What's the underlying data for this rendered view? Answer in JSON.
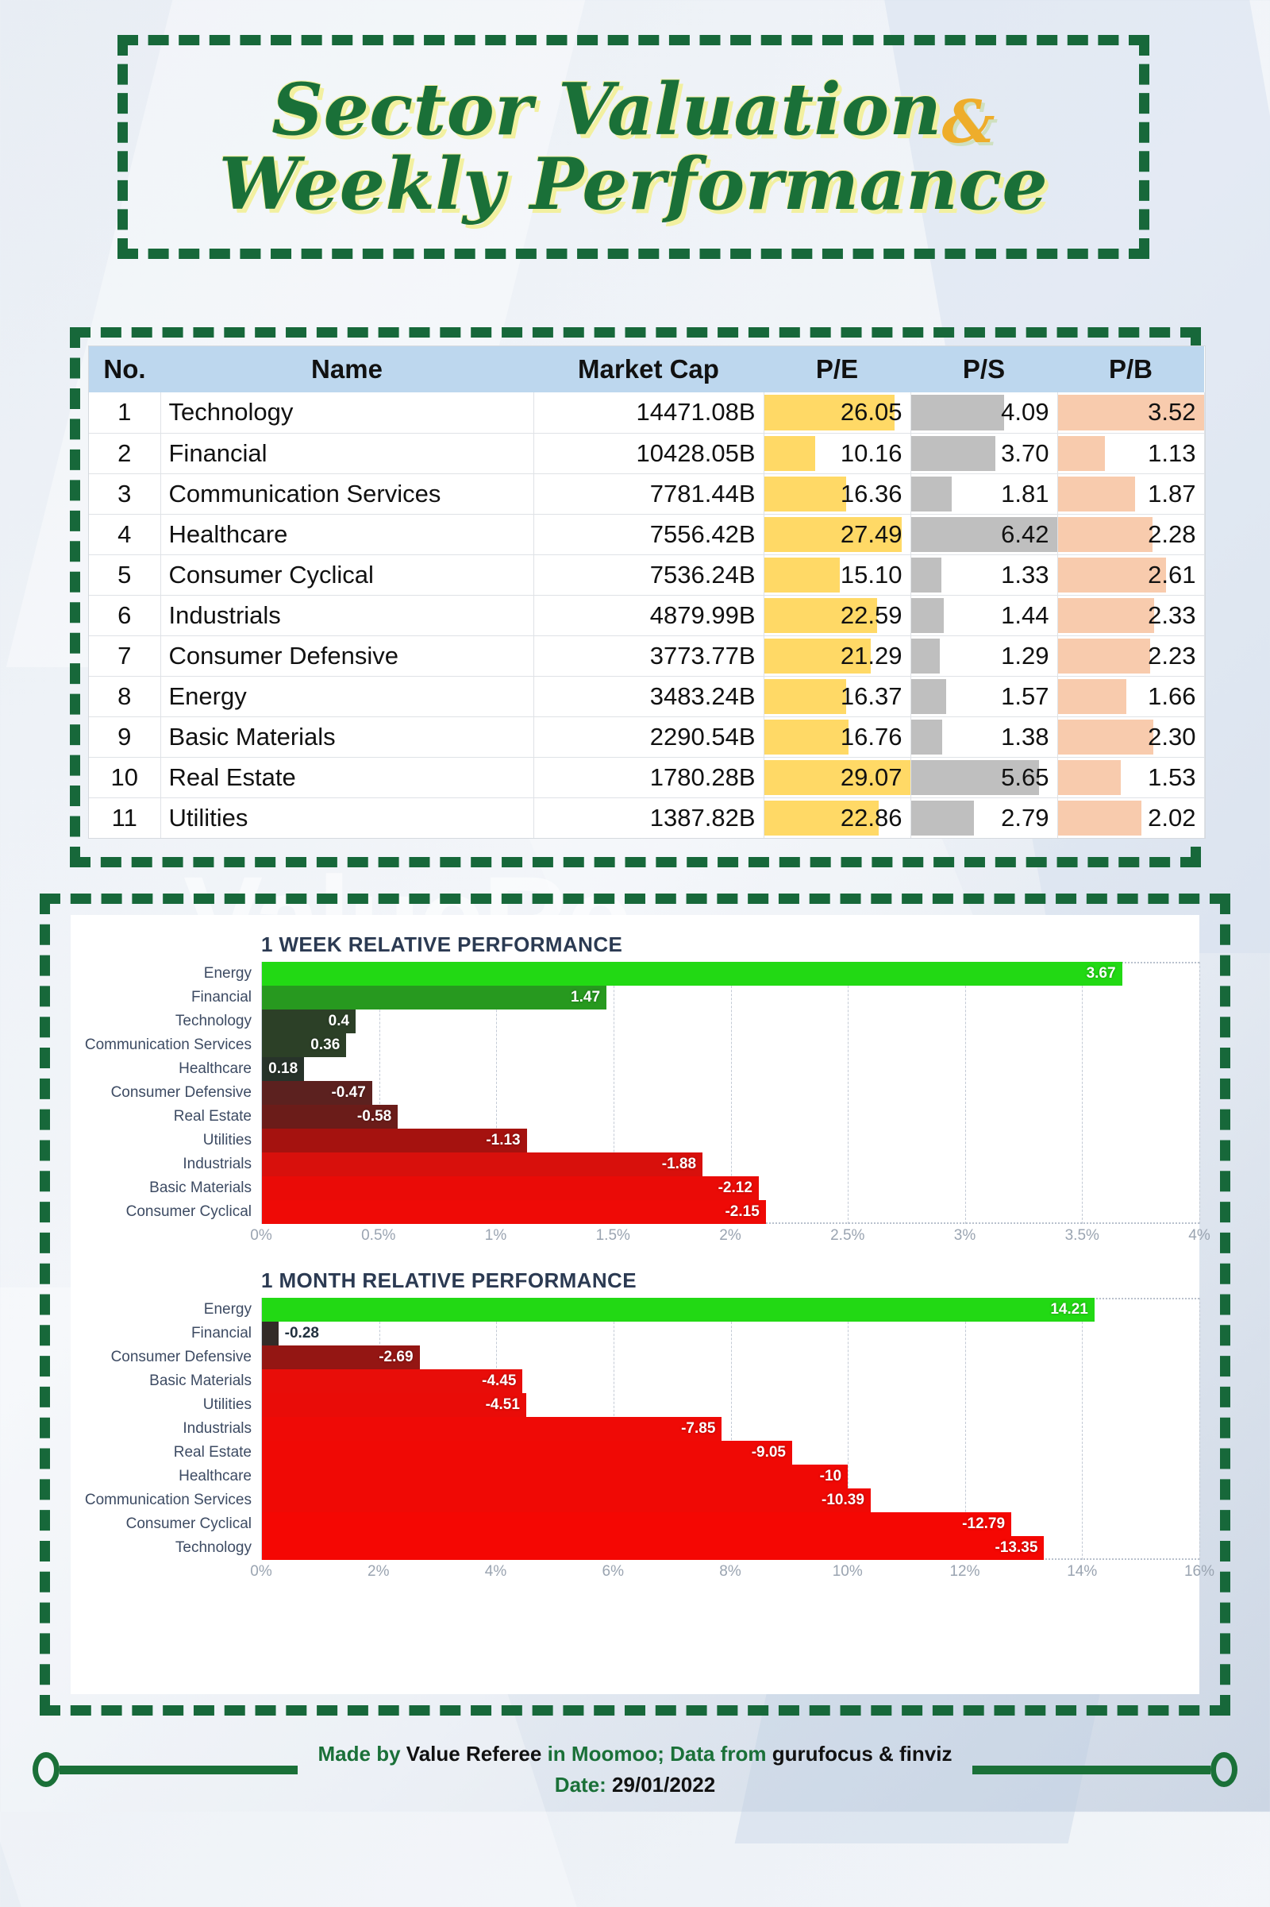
{
  "title": {
    "line1": "Sector Valuation",
    "amp": "&",
    "line2": "Weekly Performance"
  },
  "watermark_text": "ValueRe",
  "table": {
    "headers": [
      "No.",
      "Name",
      "Market Cap",
      "P/E",
      "P/S",
      "P/B"
    ],
    "colors": {
      "header_bg": "#bdd7ee",
      "pe_bar": "#ffd966",
      "ps_bar": "#bfbfbf",
      "pb_bar": "#f8cbad"
    },
    "rows": [
      {
        "no": "1",
        "name": "Technology",
        "cap": "14471.08B",
        "pe": "26.05",
        "ps": "4.09",
        "pb": "3.52"
      },
      {
        "no": "2",
        "name": "Financial",
        "cap": "10428.05B",
        "pe": "10.16",
        "ps": "3.70",
        "pb": "1.13"
      },
      {
        "no": "3",
        "name": "Communication Services",
        "cap": "7781.44B",
        "pe": "16.36",
        "ps": "1.81",
        "pb": "1.87"
      },
      {
        "no": "4",
        "name": "Healthcare",
        "cap": "7556.42B",
        "pe": "27.49",
        "ps": "6.42",
        "pb": "2.28"
      },
      {
        "no": "5",
        "name": "Consumer Cyclical",
        "cap": "7536.24B",
        "pe": "15.10",
        "ps": "1.33",
        "pb": "2.61"
      },
      {
        "no": "6",
        "name": "Industrials",
        "cap": "4879.99B",
        "pe": "22.59",
        "ps": "1.44",
        "pb": "2.33"
      },
      {
        "no": "7",
        "name": "Consumer Defensive",
        "cap": "3773.77B",
        "pe": "21.29",
        "ps": "1.29",
        "pb": "2.23"
      },
      {
        "no": "8",
        "name": "Energy",
        "cap": "3483.24B",
        "pe": "16.37",
        "ps": "1.57",
        "pb": "1.66"
      },
      {
        "no": "9",
        "name": "Basic Materials",
        "cap": "2290.54B",
        "pe": "16.76",
        "ps": "1.38",
        "pb": "2.30"
      },
      {
        "no": "10",
        "name": "Real Estate",
        "cap": "1780.28B",
        "pe": "29.07",
        "ps": "5.65",
        "pb": "1.53"
      },
      {
        "no": "11",
        "name": "Utilities",
        "cap": "1387.82B",
        "pe": "22.86",
        "ps": "2.79",
        "pb": "2.02"
      }
    ]
  },
  "chart_data": [
    {
      "type": "bar",
      "orientation": "horizontal",
      "title": "1 WEEK RELATIVE PERFORMANCE",
      "xlabel": "",
      "ylabel": "",
      "xlim": [
        0,
        4
      ],
      "xticks": [
        "0%",
        "0.5%",
        "1%",
        "1.5%",
        "2%",
        "2.5%",
        "3%",
        "3.5%",
        "4%"
      ],
      "grid": true,
      "legend": "none",
      "note": "bar length encodes absolute magnitude; sign shown in label and bar colour",
      "categories": [
        "Energy",
        "Financial",
        "Technology",
        "Communication Services",
        "Healthcare",
        "Consumer Defensive",
        "Real Estate",
        "Utilities",
        "Industrials",
        "Basic Materials",
        "Consumer Cyclical"
      ],
      "values": [
        3.67,
        1.47,
        0.4,
        0.36,
        0.18,
        -0.47,
        -0.58,
        -1.13,
        -1.88,
        -2.12,
        -2.15
      ],
      "labels": [
        "3.67",
        "1.47",
        "0.4",
        "0.36",
        "0.18",
        "-0.47",
        "-0.58",
        "-1.13",
        "-1.88",
        "-2.12",
        "-2.15"
      ],
      "bar_colors": [
        "#22d914",
        "#27991f",
        "#2c4027",
        "#2c4027",
        "#27332a",
        "#5c211f",
        "#6b1c19",
        "#a5120f",
        "#d8100c",
        "#ea0b07",
        "#ef0a06"
      ]
    },
    {
      "type": "bar",
      "orientation": "horizontal",
      "title": "1 MONTH RELATIVE PERFORMANCE",
      "xlabel": "",
      "ylabel": "",
      "xlim": [
        0,
        16
      ],
      "xticks": [
        "0%",
        "2%",
        "4%",
        "6%",
        "8%",
        "10%",
        "12%",
        "14%",
        "16%"
      ],
      "grid": true,
      "legend": "none",
      "note": "bar length encodes absolute magnitude; sign shown in label and bar colour",
      "categories": [
        "Energy",
        "Financial",
        "Consumer Defensive",
        "Basic Materials",
        "Utilities",
        "Industrials",
        "Real Estate",
        "Healthcare",
        "Communication Services",
        "Consumer Cyclical",
        "Technology"
      ],
      "values": [
        14.21,
        -0.28,
        -2.69,
        -4.45,
        -4.51,
        -7.85,
        -9.05,
        -10,
        -10.39,
        -12.79,
        -13.35
      ],
      "labels": [
        "14.21",
        "-0.28",
        "-2.69",
        "-4.45",
        "-4.51",
        "-7.85",
        "-9.05",
        "-10",
        "-10.39",
        "-12.79",
        "-13.35"
      ],
      "bar_colors": [
        "#22d914",
        "#332b28",
        "#941613",
        "#e80d09",
        "#e90c08",
        "#ef0a06",
        "#f00905",
        "#f00905",
        "#f00905",
        "#f50703",
        "#f50703"
      ]
    }
  ],
  "footer": {
    "made_by": "Made by",
    "author": "Value Referee",
    "in_platform": "in Moomoo; Data from",
    "sources": "gurufocus & finviz",
    "date_label": "Date:",
    "date_value": "29/01/2022"
  }
}
